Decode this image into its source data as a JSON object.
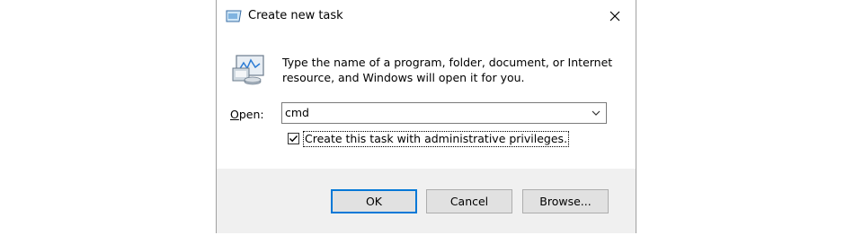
{
  "dialog": {
    "title": "Create new task",
    "description": "Type the name of a program, folder, document, or Internet resource, and Windows will open it for you.",
    "open_label": "Open:",
    "open_value": "cmd",
    "admin_checkbox_label": "Create this task with administrative privileges.",
    "admin_checked": true,
    "buttons": {
      "ok": "OK",
      "cancel": "Cancel",
      "browse": "Browse..."
    }
  },
  "colors": {
    "default_button_border": "#0078d7",
    "footer_bg": "#f0f0f0",
    "button_bg": "#e1e1e1"
  }
}
